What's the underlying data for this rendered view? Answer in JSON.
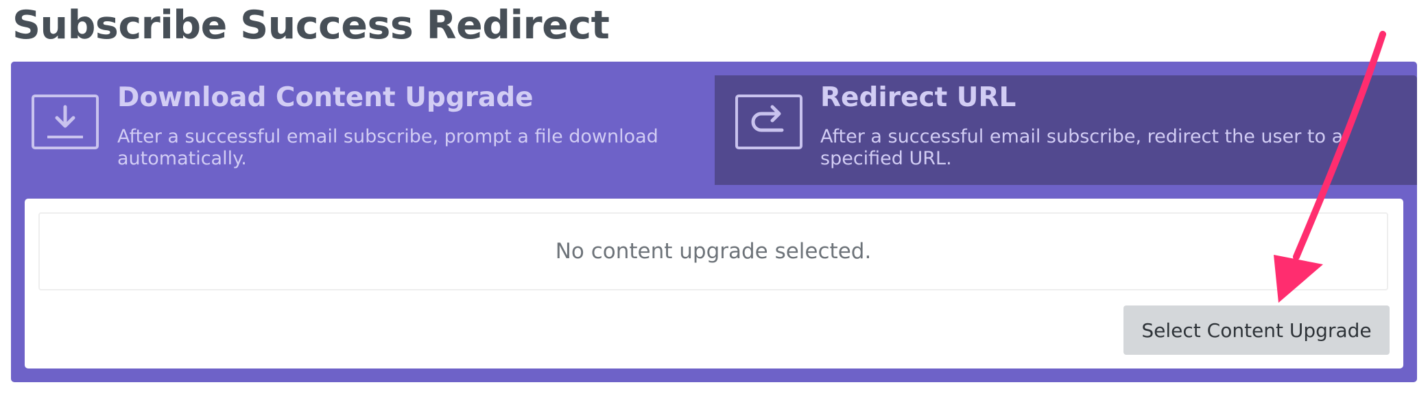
{
  "page": {
    "title": "Subscribe Success Redirect"
  },
  "tabs": [
    {
      "title": "Download Content Upgrade",
      "description": "After a successful email subscribe, prompt a file download automatically.",
      "icon": "download-icon",
      "active": true
    },
    {
      "title": "Redirect URL",
      "description": "After a successful email subscribe, redirect the user to a specified URL.",
      "icon": "redirect-icon",
      "active": false
    }
  ],
  "content": {
    "empty_message": "No content upgrade selected.",
    "select_button_label": "Select Content Upgrade"
  },
  "annotation": {
    "icon": "pointer-arrow-icon",
    "color": "#ff2d6f"
  },
  "colors": {
    "active_tab": "#6e62c8",
    "inactive_tab": "#52498f",
    "title_text": "#474f57"
  }
}
